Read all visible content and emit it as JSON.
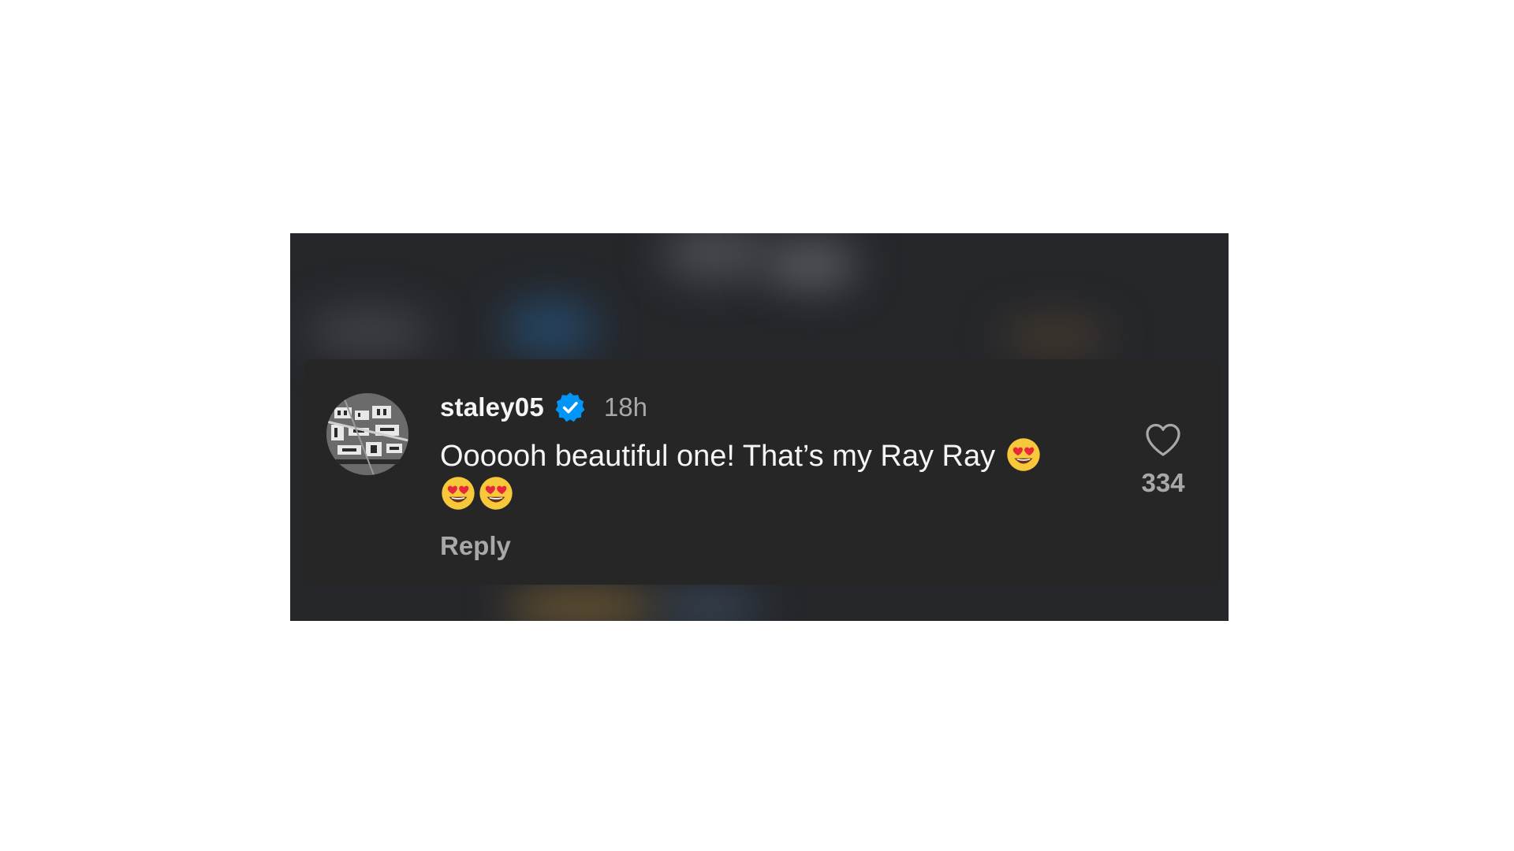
{
  "comment": {
    "username": "staley05",
    "verified": true,
    "timestamp": "18h",
    "text_line1": "Oooooh beautiful one!  That’s my Ray Ray",
    "emojis": [
      "heart-eyes",
      "heart-eyes",
      "heart-eyes"
    ],
    "reply_label": "Reply",
    "like_count": "334"
  },
  "icons": {
    "verified": "verified-badge-icon",
    "like": "heart-outline-icon",
    "emoji": "smiling-face-with-heart-eyes"
  },
  "colors": {
    "card_bg": "#262626",
    "outer_bg": "#25272b",
    "primary_text": "#f5f5f5",
    "secondary_text": "#a8a8a8",
    "verified_blue": "#0095f6"
  }
}
